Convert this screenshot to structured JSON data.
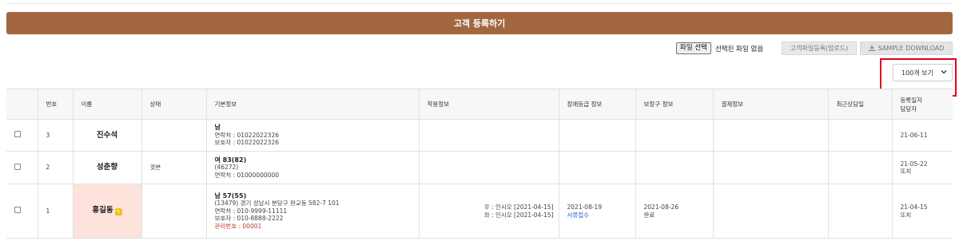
{
  "register_button": "고객 등록하기",
  "file": {
    "choose_label": "파일 선택",
    "status": "선택된 파일 없음",
    "upload_label": "고객파일등록(업로드)",
    "sample_label": "SAMPLE DOWNLOAD"
  },
  "per_page": {
    "selected": "100개 보기"
  },
  "table": {
    "headers": {
      "no": "번호",
      "name": "이름",
      "status": "상태",
      "basic": "기본정보",
      "wear": "착용정보",
      "disability": "장애등급 정보",
      "assistive": "보장구 정보",
      "payment": "결제정보",
      "recent": "최근상담일",
      "reg_line1": "등록일자",
      "reg_line2": "담당자"
    },
    "rows": [
      {
        "no": "3",
        "name": "진수석",
        "status": "",
        "basic_title": "남",
        "basic_lines": [
          "연락처 : 01022022326",
          "보호자 : 01022022326"
        ],
        "wear": [
          "",
          ""
        ],
        "disability": [
          "",
          ""
        ],
        "assistive": [
          "",
          ""
        ],
        "payment": "",
        "recent": "",
        "reg_date": "21-06-11",
        "manager": ""
      },
      {
        "no": "2",
        "name": "성춘향",
        "status": "귓본",
        "basic_title": "여 83(82)",
        "basic_lines": [
          "(46272)",
          "연락처 : 01000000000"
        ],
        "wear": [
          "",
          ""
        ],
        "disability": [
          "",
          ""
        ],
        "assistive": [
          "",
          ""
        ],
        "payment": "",
        "recent": "",
        "reg_date": "21-05-22",
        "manager": "또치"
      },
      {
        "no": "1",
        "name": "홍길동",
        "status": "",
        "basic_title": "남 57(55)",
        "basic_lines": [
          "(13479) 경기 성남시 분당구 판교동 582-7 101",
          "연락처 : 010-9999-11111",
          "보호자 : 010-8888-2222"
        ],
        "basic_extra": "관리번호 : 00001",
        "wear": [
          "우 : 인시오 [2021-04-15]",
          "좌 : 인시오 [2021-04-15]"
        ],
        "disability": [
          "2021-08-19",
          "서류접수"
        ],
        "assistive": [
          "2021-08-26",
          "완료"
        ],
        "payment": "",
        "recent": "",
        "reg_date": "21-04-15",
        "manager": "또치"
      }
    ]
  },
  "colors": {
    "register_button_bg": "#a3673f",
    "highlight_border": "#e4001b",
    "selected_row_name_bg": "#fde3dc",
    "management_no": "#c0392b",
    "document_status": "#2b5cd6"
  },
  "icons": {
    "download": "download-icon",
    "dropdown": "chevron-down-icon",
    "name_badge": "memo-icon"
  }
}
